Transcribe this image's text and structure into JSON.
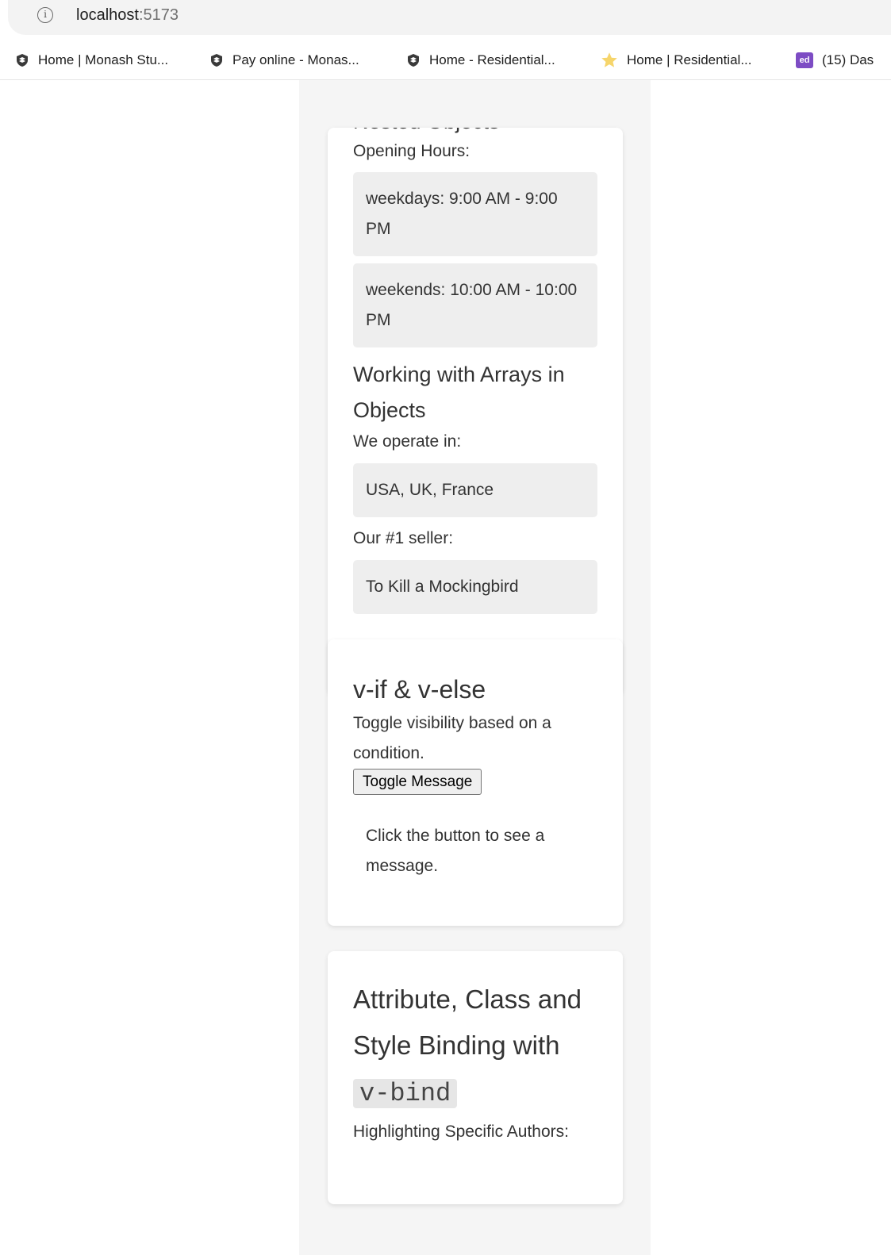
{
  "browser": {
    "url_host": "localhost",
    "url_port": ":5173",
    "bookmarks": [
      {
        "label": "Home | Monash Stu...",
        "icon": "monash-shield-icon"
      },
      {
        "label": "Pay online - Monas...",
        "icon": "monash-shield-icon"
      },
      {
        "label": "Home - Residential...",
        "icon": "monash-shield-icon"
      },
      {
        "label": "Home | Residential...",
        "icon": "star-icon"
      },
      {
        "label": "(15) Das",
        "icon": "ed-icon",
        "icon_text": "ed"
      }
    ]
  },
  "nested": {
    "heading_partial": "Nested Objects",
    "opening_label": "Opening Hours:",
    "hours": [
      "weekdays: 9:00 AM - 9:00 PM",
      "weekends: 10:00 AM - 10:00 PM"
    ]
  },
  "arrays": {
    "heading": "Working with Arrays in Objects",
    "operate_label": "We operate in:",
    "countries": "USA, UK, France",
    "seller_label": "Our #1 seller:",
    "seller": "To Kill a Mockingbird"
  },
  "vif": {
    "heading": "v-if & v-else",
    "description": "Toggle visibility based on a condition.",
    "button_label": "Toggle Message",
    "message": "Click the button to see a message."
  },
  "binding": {
    "heading_text": "Attribute, Class and Style Binding with",
    "heading_code": "v-bind",
    "subtext": "Highlighting Specific Authors:"
  },
  "colors": {
    "page_bg": "#f5f5f5",
    "card_bg": "#ffffff",
    "box_bg": "#eeeeee",
    "text": "#333333"
  }
}
